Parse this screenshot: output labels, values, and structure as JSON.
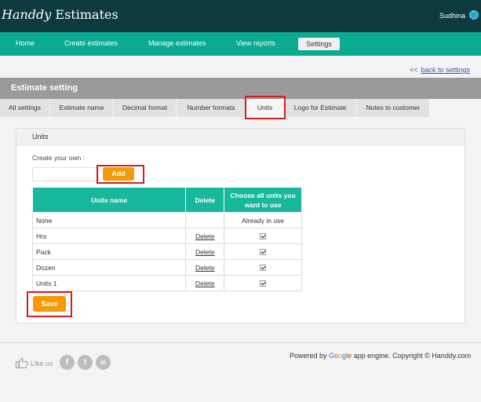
{
  "header": {
    "logo_part1": "Handdy",
    "logo_part2": " Estimates",
    "user_name": "Sudhina"
  },
  "nav": {
    "items": [
      {
        "label": "Home"
      },
      {
        "label": "Create estimates"
      },
      {
        "label": "Manage estimates"
      },
      {
        "label": "View reports"
      },
      {
        "label": "Settings"
      }
    ],
    "active": "Settings"
  },
  "back_link": {
    "arrow": "<<",
    "label": "back to settings"
  },
  "page_title": "Estimate setting",
  "tabs": [
    {
      "label": "All settings"
    },
    {
      "label": "Estimate name"
    },
    {
      "label": "Decimal format"
    },
    {
      "label": "Number formats"
    },
    {
      "label": "Units"
    },
    {
      "label": "Logo for Estimate"
    },
    {
      "label": "Notes to customer"
    }
  ],
  "active_tab": "Units",
  "units_panel": {
    "heading": "Units",
    "create_label": "Create your own :",
    "input_value": "",
    "add_label": "Add",
    "table": {
      "headers": [
        "Units name",
        "Delete",
        "Choose all units you want to use"
      ],
      "rows": [
        {
          "name": "None",
          "delete": "",
          "use": "Already in use",
          "checked": null
        },
        {
          "name": "Hrs",
          "delete": "Delete",
          "use": "",
          "checked": true
        },
        {
          "name": "Pack",
          "delete": "Delete",
          "use": "",
          "checked": true
        },
        {
          "name": "Dozen",
          "delete": "Delete",
          "use": "",
          "checked": true
        },
        {
          "name": "Units 1",
          "delete": "Delete",
          "use": "",
          "checked": true
        }
      ]
    },
    "save_label": "Save"
  },
  "footer": {
    "like_label": "Like us",
    "social": [
      {
        "icon": "facebook-icon",
        "glyph": "f"
      },
      {
        "icon": "twitter-icon",
        "glyph": "t"
      },
      {
        "icon": "linkedin-icon",
        "glyph": "in"
      }
    ],
    "powered_prefix": "Powered by ",
    "powered_brand": "Google",
    "powered_suffix": " app engine. Copyright © Handdy.com"
  },
  "colors": {
    "header_bg": "#0c3a3e",
    "nav_bg": "#0aab90",
    "table_header": "#17b89b",
    "button_orange": "#f59a00",
    "highlight_red": "#d21e1e"
  }
}
